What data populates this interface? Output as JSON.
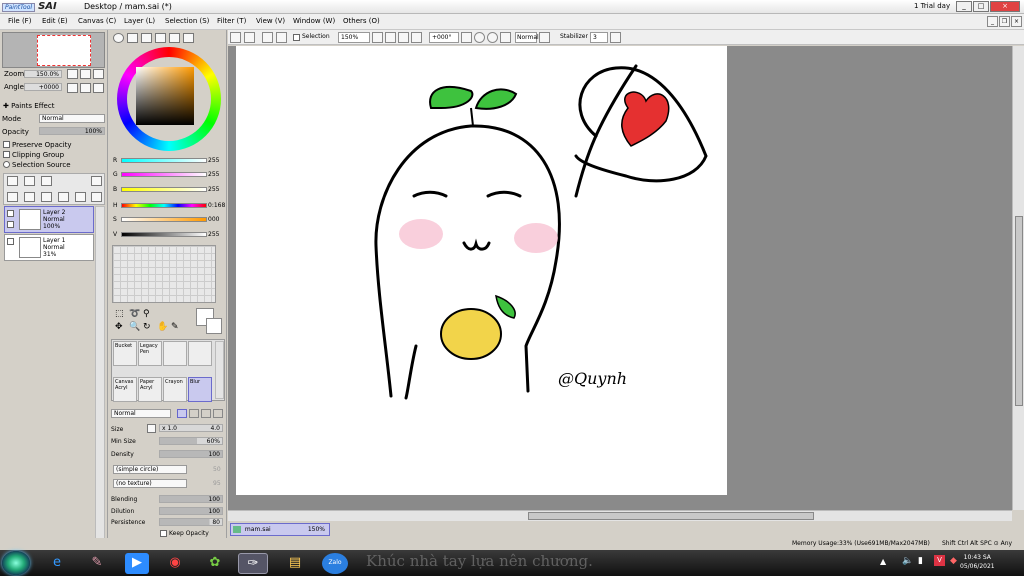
{
  "window": {
    "logo": "SAI",
    "logo_prefix": "PaintTool",
    "title": "Desktop / mam.sai (*)",
    "trial": "1 Trial day",
    "btn_min": "_",
    "btn_max": "□",
    "btn_close": "×"
  },
  "menu": [
    "File (F)",
    "Edit (E)",
    "Canvas (C)",
    "Layer (L)",
    "Selection (S)",
    "Filter (T)",
    "View (V)",
    "Window (W)",
    "Others (O)"
  ],
  "navigator": {
    "zoom_label": "Zoom",
    "zoom_value": "150.0%",
    "angle_label": "Angle",
    "angle_value": "+0000"
  },
  "layer_panel": {
    "paints_effect": "Paints Effect",
    "mode_label": "Mode",
    "mode_value": "Normal",
    "opacity_label": "Opacity",
    "opacity_value": "100%",
    "preserve_opacity": "Preserve Opacity",
    "clipping_group": "Clipping Group",
    "selection_source": "Selection Source",
    "layers": [
      {
        "name": "Layer 2",
        "mode": "Normal",
        "opacity": "100%",
        "selected": true
      },
      {
        "name": "Layer 1",
        "mode": "Normal",
        "opacity": "31%",
        "selected": false
      }
    ]
  },
  "color": {
    "r_label": "R",
    "r_value": "255",
    "g_label": "G",
    "g_value": "255",
    "b_label": "B",
    "b_value": "255",
    "h_label": "H",
    "h_value": "0:168",
    "s_label": "S",
    "s_value": "000",
    "v_label": "V",
    "v_value": "255"
  },
  "tools": [
    {
      "top": "Bucket",
      "bottom": "",
      "selected": false
    },
    {
      "top": "Legacy",
      "bottom": "Pen",
      "selected": false
    },
    {
      "top": "Canvas",
      "bottom": "Acryl",
      "selected": false
    },
    {
      "top": "Paper",
      "bottom": "Acryl",
      "selected": false
    },
    {
      "top": "Crayon",
      "bottom": "",
      "selected": false
    },
    {
      "top": "Blur",
      "bottom": "",
      "selected": true
    }
  ],
  "brush": {
    "blend_mode": "Normal",
    "size_label": "Size",
    "size_mult": "x 1.0",
    "size_value": "4.0",
    "min_size_label": "Min Size",
    "min_size_value": "60%",
    "density_label": "Density",
    "density_value": "100",
    "shape": "(simple circle)",
    "shape_value": "50",
    "texture": "(no texture)",
    "texture_value": "95",
    "blending_label": "Blending",
    "blending_value": "100",
    "dilution_label": "Dilution",
    "dilution_value": "100",
    "persistence_label": "Persistence",
    "persistence_value": "80",
    "keep_opacity": "Keep Opacity"
  },
  "toolbar": {
    "selection_label": "Selection",
    "zoom_value": "150%",
    "angle_value": "+000°",
    "blend_value": "Normal",
    "stabilizer_label": "Stabilizer",
    "stabilizer_value": "3"
  },
  "canvas": {
    "signature": "@Quynh"
  },
  "doc_tab": {
    "name": "mam.sai",
    "zoom": "150%"
  },
  "status": {
    "memory": "Memory Usage:33% (Use691MB/Max2047MB)",
    "keys": "Shift Ctrl Alt SPC ⊙ Any"
  },
  "taskbar": {
    "bg_text": "Khúc nhà tay lựa nên chương.",
    "time": "10:43 SA",
    "date": "05/06/2021",
    "zalo": "Zalo"
  }
}
